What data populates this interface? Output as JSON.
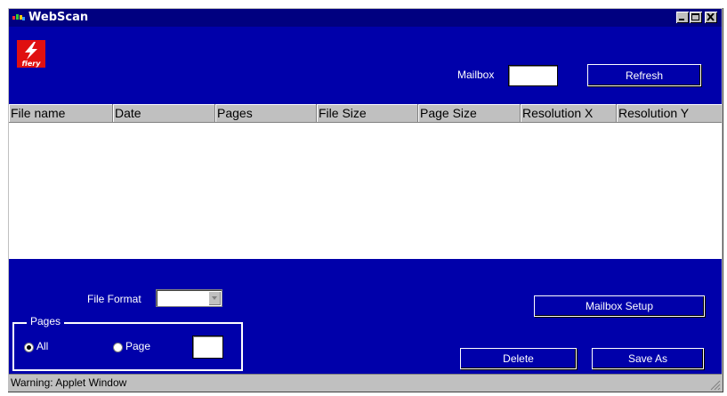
{
  "window": {
    "title": "WebScan",
    "title_icon": "webscan-app-icon",
    "controls": [
      "minimize-icon",
      "maximize-icon",
      "close-icon"
    ]
  },
  "header": {
    "logo_text": "fiery",
    "mailbox_label": "Mailbox",
    "mailbox_value": "",
    "refresh_label": "Refresh"
  },
  "table": {
    "columns": [
      "File name",
      "Date",
      "Pages",
      "File Size",
      "Page Size",
      "Resolution X",
      "Resolution Y"
    ],
    "rows": []
  },
  "footer": {
    "file_format_label": "File Format",
    "file_format_value": "",
    "mailbox_setup_label": "Mailbox Setup",
    "pages_group_label": "Pages",
    "radio_all_label": "All",
    "radio_page_label": "Page",
    "radio_selected": "All",
    "page_value": "",
    "delete_label": "Delete",
    "save_as_label": "Save As"
  },
  "status": {
    "text": "Warning: Applet Window"
  },
  "colors": {
    "title_bar": "#000080",
    "panel_blue": "#0000aa",
    "chrome_gray": "#c0c0c0",
    "logo_red": "#e01010"
  }
}
